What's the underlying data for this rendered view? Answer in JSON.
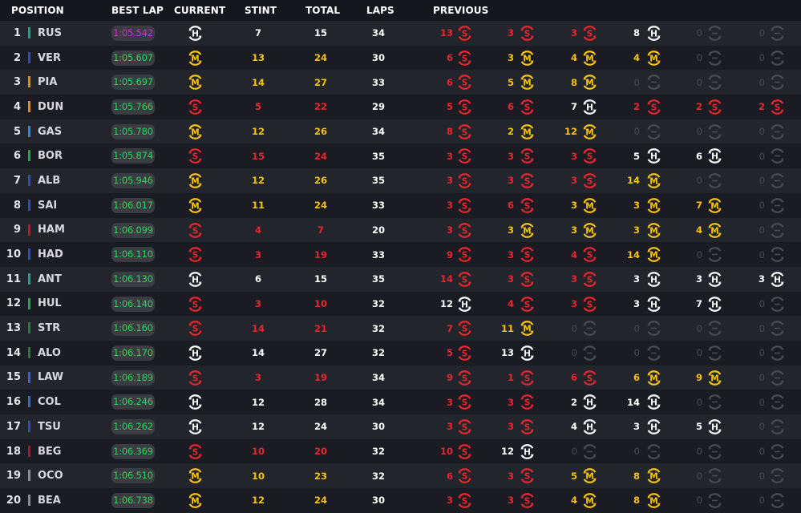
{
  "header": {
    "position": "POSITION",
    "best_lap": "BEST LAP",
    "current": "CURRENT",
    "stint": "STINT",
    "total": "TOTAL",
    "laps": "LAPS",
    "previous": "PREVIOUS"
  },
  "colors": {
    "tyre_H": "#ffffff",
    "tyre_M": "#f5c316",
    "tyre_S": "#e8262d",
    "tyre_empty": "#4a4b52",
    "lap_green": "#27d85a",
    "lap_purple": "#d62bd8",
    "white": "#ffffff",
    "empty": "#4a4b52"
  },
  "rows": [
    {
      "pos": "1",
      "code": "RUS",
      "team": "#1aa38b",
      "best": "1:05.542",
      "bestColor": "lap_purple",
      "current": "H",
      "stint": "7",
      "total": "15",
      "laps": "34",
      "previous": [
        {
          "n": "13",
          "t": "S"
        },
        {
          "n": "3",
          "t": "S"
        },
        {
          "n": "3",
          "t": "S"
        },
        {
          "n": "8",
          "t": "H"
        },
        {
          "n": "0",
          "t": "E"
        },
        {
          "n": "0",
          "t": "E"
        }
      ]
    },
    {
      "pos": "2",
      "code": "VER",
      "team": "#2b4eb0",
      "best": "1:05.607",
      "bestColor": "lap_green",
      "current": "M",
      "stint": "13",
      "total": "24",
      "laps": "30",
      "previous": [
        {
          "n": "6",
          "t": "S"
        },
        {
          "n": "3",
          "t": "M"
        },
        {
          "n": "4",
          "t": "M"
        },
        {
          "n": "4",
          "t": "M"
        },
        {
          "n": "0",
          "t": "E"
        },
        {
          "n": "0",
          "t": "E"
        }
      ]
    },
    {
      "pos": "3",
      "code": "PIA",
      "team": "#e8861a",
      "best": "1:05.697",
      "bestColor": "lap_green",
      "current": "M",
      "stint": "14",
      "total": "27",
      "laps": "33",
      "previous": [
        {
          "n": "6",
          "t": "S"
        },
        {
          "n": "5",
          "t": "M"
        },
        {
          "n": "8",
          "t": "M"
        },
        {
          "n": "0",
          "t": "E"
        },
        {
          "n": "0",
          "t": "E"
        },
        {
          "n": "0",
          "t": "E"
        }
      ]
    },
    {
      "pos": "4",
      "code": "DUN",
      "team": "#e8861a",
      "best": "1:05.766",
      "bestColor": "lap_green",
      "current": "S",
      "stint": "5",
      "total": "22",
      "laps": "29",
      "previous": [
        {
          "n": "5",
          "t": "S"
        },
        {
          "n": "6",
          "t": "S"
        },
        {
          "n": "7",
          "t": "H"
        },
        {
          "n": "2",
          "t": "S"
        },
        {
          "n": "2",
          "t": "S"
        },
        {
          "n": "2",
          "t": "S"
        }
      ]
    },
    {
      "pos": "5",
      "code": "GAS",
      "team": "#1f8fd8",
      "best": "1:05.780",
      "bestColor": "lap_green",
      "current": "M",
      "stint": "12",
      "total": "26",
      "laps": "34",
      "previous": [
        {
          "n": "8",
          "t": "S"
        },
        {
          "n": "2",
          "t": "M"
        },
        {
          "n": "12",
          "t": "M"
        },
        {
          "n": "0",
          "t": "E"
        },
        {
          "n": "0",
          "t": "E"
        },
        {
          "n": "0",
          "t": "E"
        }
      ]
    },
    {
      "pos": "6",
      "code": "BOR",
      "team": "#1fa84a",
      "best": "1:05.874",
      "bestColor": "lap_green",
      "current": "S",
      "stint": "15",
      "total": "24",
      "laps": "35",
      "previous": [
        {
          "n": "3",
          "t": "S"
        },
        {
          "n": "3",
          "t": "S"
        },
        {
          "n": "3",
          "t": "S"
        },
        {
          "n": "5",
          "t": "H"
        },
        {
          "n": "6",
          "t": "H"
        },
        {
          "n": "0",
          "t": "E"
        }
      ]
    },
    {
      "pos": "7",
      "code": "ALB",
      "team": "#2b4eb0",
      "best": "1:05.946",
      "bestColor": "lap_green",
      "current": "M",
      "stint": "12",
      "total": "26",
      "laps": "35",
      "previous": [
        {
          "n": "3",
          "t": "S"
        },
        {
          "n": "3",
          "t": "S"
        },
        {
          "n": "3",
          "t": "S"
        },
        {
          "n": "14",
          "t": "M"
        },
        {
          "n": "0",
          "t": "E"
        },
        {
          "n": "0",
          "t": "E"
        }
      ]
    },
    {
      "pos": "8",
      "code": "SAI",
      "team": "#2b4eb0",
      "best": "1:06.017",
      "bestColor": "lap_green",
      "current": "M",
      "stint": "11",
      "total": "24",
      "laps": "33",
      "previous": [
        {
          "n": "3",
          "t": "S"
        },
        {
          "n": "6",
          "t": "S"
        },
        {
          "n": "3",
          "t": "M"
        },
        {
          "n": "3",
          "t": "M"
        },
        {
          "n": "7",
          "t": "M"
        },
        {
          "n": "0",
          "t": "E"
        }
      ]
    },
    {
      "pos": "9",
      "code": "HAM",
      "team": "#c4142b",
      "best": "1:06.099",
      "bestColor": "lap_green",
      "current": "S",
      "stint": "4",
      "total": "7",
      "laps": "20",
      "previous": [
        {
          "n": "3",
          "t": "S"
        },
        {
          "n": "3",
          "t": "M"
        },
        {
          "n": "3",
          "t": "M"
        },
        {
          "n": "3",
          "t": "M"
        },
        {
          "n": "4",
          "t": "M"
        },
        {
          "n": "0",
          "t": "E"
        }
      ]
    },
    {
      "pos": "10",
      "code": "HAD",
      "team": "#2b4eb0",
      "best": "1:06.110",
      "bestColor": "lap_green",
      "current": "S",
      "stint": "3",
      "total": "19",
      "laps": "33",
      "previous": [
        {
          "n": "9",
          "t": "S"
        },
        {
          "n": "3",
          "t": "S"
        },
        {
          "n": "4",
          "t": "S"
        },
        {
          "n": "14",
          "t": "M"
        },
        {
          "n": "0",
          "t": "E"
        },
        {
          "n": "0",
          "t": "E"
        }
      ]
    },
    {
      "pos": "11",
      "code": "ANT",
      "team": "#1aa38b",
      "best": "1:06.130",
      "bestColor": "lap_green",
      "current": "H",
      "stint": "6",
      "total": "15",
      "laps": "35",
      "previous": [
        {
          "n": "14",
          "t": "S"
        },
        {
          "n": "3",
          "t": "S"
        },
        {
          "n": "3",
          "t": "S"
        },
        {
          "n": "3",
          "t": "H"
        },
        {
          "n": "3",
          "t": "H"
        },
        {
          "n": "3",
          "t": "H"
        }
      ]
    },
    {
      "pos": "12",
      "code": "HUL",
      "team": "#1fa84a",
      "best": "1:06.140",
      "bestColor": "lap_green",
      "current": "S",
      "stint": "3",
      "total": "10",
      "laps": "32",
      "previous": [
        {
          "n": "12",
          "t": "H"
        },
        {
          "n": "4",
          "t": "S"
        },
        {
          "n": "3",
          "t": "S"
        },
        {
          "n": "3",
          "t": "H"
        },
        {
          "n": "7",
          "t": "H"
        },
        {
          "n": "0",
          "t": "E"
        }
      ]
    },
    {
      "pos": "13",
      "code": "STR",
      "team": "#1f7a4a",
      "best": "1:06.160",
      "bestColor": "lap_green",
      "current": "S",
      "stint": "14",
      "total": "21",
      "laps": "32",
      "previous": [
        {
          "n": "7",
          "t": "S"
        },
        {
          "n": "11",
          "t": "M"
        },
        {
          "n": "0",
          "t": "E"
        },
        {
          "n": "0",
          "t": "E"
        },
        {
          "n": "0",
          "t": "E"
        },
        {
          "n": "0",
          "t": "E"
        }
      ]
    },
    {
      "pos": "14",
      "code": "ALO",
      "team": "#1f7a4a",
      "best": "1:06.170",
      "bestColor": "lap_green",
      "current": "H",
      "stint": "14",
      "total": "27",
      "laps": "32",
      "previous": [
        {
          "n": "5",
          "t": "S"
        },
        {
          "n": "13",
          "t": "H"
        },
        {
          "n": "0",
          "t": "E"
        },
        {
          "n": "0",
          "t": "E"
        },
        {
          "n": "0",
          "t": "E"
        },
        {
          "n": "0",
          "t": "E"
        }
      ]
    },
    {
      "pos": "15",
      "code": "LAW",
      "team": "#3a63c8",
      "best": "1:06.189",
      "bestColor": "lap_green",
      "current": "S",
      "stint": "3",
      "total": "19",
      "laps": "34",
      "previous": [
        {
          "n": "9",
          "t": "S"
        },
        {
          "n": "1",
          "t": "S"
        },
        {
          "n": "6",
          "t": "S"
        },
        {
          "n": "6",
          "t": "M"
        },
        {
          "n": "9",
          "t": "M"
        },
        {
          "n": "0",
          "t": "E"
        }
      ]
    },
    {
      "pos": "16",
      "code": "COL",
      "team": "#2b6cd0",
      "best": "1:06.246",
      "bestColor": "lap_green",
      "current": "H",
      "stint": "12",
      "total": "28",
      "laps": "34",
      "previous": [
        {
          "n": "3",
          "t": "S"
        },
        {
          "n": "3",
          "t": "S"
        },
        {
          "n": "2",
          "t": "H"
        },
        {
          "n": "14",
          "t": "H"
        },
        {
          "n": "0",
          "t": "E"
        },
        {
          "n": "0",
          "t": "E"
        }
      ]
    },
    {
      "pos": "17",
      "code": "TSU",
      "team": "#2b4eb0",
      "best": "1:06.262",
      "bestColor": "lap_green",
      "current": "H",
      "stint": "12",
      "total": "24",
      "laps": "30",
      "previous": [
        {
          "n": "3",
          "t": "S"
        },
        {
          "n": "3",
          "t": "S"
        },
        {
          "n": "4",
          "t": "H"
        },
        {
          "n": "3",
          "t": "H"
        },
        {
          "n": "5",
          "t": "H"
        },
        {
          "n": "0",
          "t": "E"
        }
      ]
    },
    {
      "pos": "18",
      "code": "BEG",
      "team": "#b0122a",
      "best": "1:06.369",
      "bestColor": "lap_green",
      "current": "S",
      "stint": "10",
      "total": "20",
      "laps": "32",
      "previous": [
        {
          "n": "10",
          "t": "S"
        },
        {
          "n": "12",
          "t": "H"
        },
        {
          "n": "0",
          "t": "E"
        },
        {
          "n": "0",
          "t": "E"
        },
        {
          "n": "0",
          "t": "E"
        },
        {
          "n": "0",
          "t": "E"
        }
      ]
    },
    {
      "pos": "19",
      "code": "OCO",
      "team": "#8a8c94",
      "best": "1:06.510",
      "bestColor": "lap_green",
      "current": "M",
      "stint": "10",
      "total": "23",
      "laps": "32",
      "previous": [
        {
          "n": "6",
          "t": "S"
        },
        {
          "n": "3",
          "t": "S"
        },
        {
          "n": "5",
          "t": "M"
        },
        {
          "n": "8",
          "t": "M"
        },
        {
          "n": "0",
          "t": "E"
        },
        {
          "n": "0",
          "t": "E"
        }
      ]
    },
    {
      "pos": "20",
      "code": "BEA",
      "team": "#8a8c94",
      "best": "1:06.738",
      "bestColor": "lap_green",
      "current": "M",
      "stint": "12",
      "total": "24",
      "laps": "30",
      "previous": [
        {
          "n": "3",
          "t": "S"
        },
        {
          "n": "3",
          "t": "S"
        },
        {
          "n": "4",
          "t": "M"
        },
        {
          "n": "8",
          "t": "M"
        },
        {
          "n": "0",
          "t": "E"
        },
        {
          "n": "0",
          "t": "E"
        }
      ]
    }
  ]
}
